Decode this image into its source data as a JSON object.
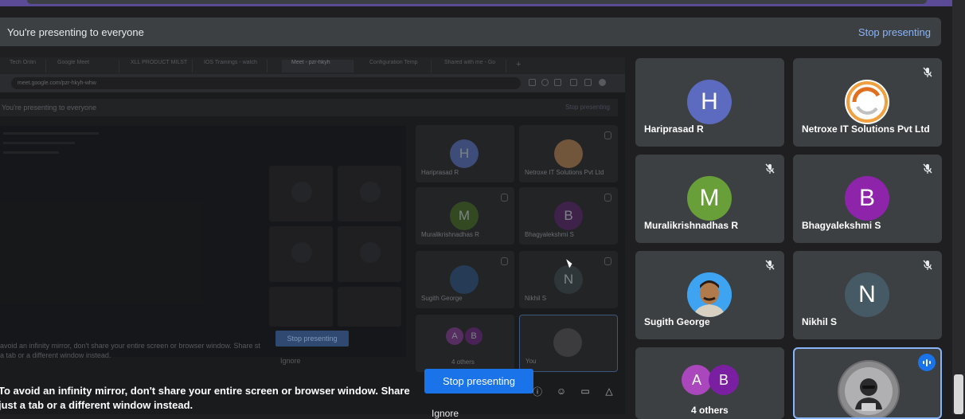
{
  "banner": {
    "message": "You're presenting to everyone",
    "stop_label": "Stop presenting"
  },
  "shared_screen": {
    "tabs": [
      "Tech Onlin",
      "Google Meet",
      "XLL PRODUCT MILST",
      "IOS Trainings - watch",
      "Meet - pzr-hkyh",
      "Configuration Temp",
      "Shared with me - Go"
    ],
    "url": "meet.google.com/pzr-hkyh-whw",
    "inner_banner_message": "You're presenting to everyone",
    "inner_banner_stop": "Stop presenting",
    "inner_stop_button": "Stop presenting",
    "inner_hint": "avoid an infinity mirror, don't share your entire screen or browser window. Share st a tab or a different window instead.",
    "inner_ignore": "Ignore",
    "mini_tiles": [
      {
        "name": "Hariprasad R",
        "initial": "H",
        "color": "#4b5d94"
      },
      {
        "name": "Netroxe IT Solutions Pvt Ltd",
        "initial": "",
        "color": "#6b4a2e"
      },
      {
        "name": "Muralikrishnadhas R",
        "initial": "M",
        "color": "#3f5a2a"
      },
      {
        "name": "Bhagyalekshmi S",
        "initial": "B",
        "color": "#4d2a5a"
      },
      {
        "name": "Sugith George",
        "initial": "",
        "color": "#2f4a6a"
      },
      {
        "name": "Nikhil S",
        "initial": "N",
        "color": "#3a4347"
      },
      {
        "name": "4 others",
        "initial": "",
        "color": "#3a3b3e"
      },
      {
        "name": "You",
        "initial": "",
        "color": "#3a3b3e"
      }
    ]
  },
  "hint": {
    "text": "To avoid an infinity mirror, don't share your entire screen or browser window. Share just a tab or a different window instead."
  },
  "stop_button": {
    "label": "Stop presenting"
  },
  "ignore": {
    "label": "Ignore"
  },
  "participants": [
    {
      "name": "Hariprasad R",
      "initial": "H",
      "color": "#5c6bc0",
      "mic": "none"
    },
    {
      "name": "Netroxe IT Solutions Pvt Ltd",
      "initial": "",
      "color": "#ffffff",
      "mic": "muted",
      "logo": true
    },
    {
      "name": "Muralikrishnadhas R",
      "initial": "M",
      "color": "#689f38",
      "mic": "muted"
    },
    {
      "name": "Bhagyalekshmi S",
      "initial": "B",
      "color": "#8e24aa",
      "mic": "muted"
    },
    {
      "name": "Sugith George",
      "initial": "",
      "color": "#2196f3",
      "mic": "muted",
      "photo": true
    },
    {
      "name": "Nikhil S",
      "initial": "N",
      "color": "#455a64",
      "mic": "muted"
    },
    {
      "name": "4 others",
      "initial_a": "A",
      "initial_b": "B",
      "color_a": "#ab47bc",
      "color_b": "#7b1fa2",
      "mic": "none"
    },
    {
      "name": "You",
      "initial": "",
      "color": "#9e9e9e",
      "mic": "speaking"
    }
  ]
}
